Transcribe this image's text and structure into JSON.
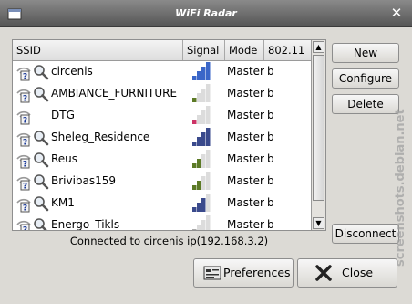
{
  "window": {
    "title": "WiFi Radar"
  },
  "columns": {
    "ssid": "SSID",
    "signal": "Signal",
    "mode": "Mode",
    "standard": "802.11"
  },
  "networks": [
    {
      "ssid": "circenis",
      "signal_bars": 4,
      "signal_color": "#3a66c8",
      "mode": "Master",
      "standard": "b"
    },
    {
      "ssid": "AMBIANCE_FURNITURE",
      "signal_bars": 1,
      "signal_color": "#5c7a26",
      "mode": "Master",
      "standard": "b"
    },
    {
      "ssid": "DTG",
      "signal_bars": 1,
      "signal_color": "#cc3366",
      "mode": "Master",
      "standard": "b"
    },
    {
      "ssid": "Sheleg_Residence",
      "signal_bars": 4,
      "signal_color": "#3a4a8c",
      "mode": "Master",
      "standard": "b"
    },
    {
      "ssid": "Reus",
      "signal_bars": 2,
      "signal_color": "#5c7a26",
      "mode": "Master",
      "standard": "b"
    },
    {
      "ssid": "Brivibas159",
      "signal_bars": 2,
      "signal_color": "#5c7a26",
      "mode": "Master",
      "standard": "b"
    },
    {
      "ssid": "KM1",
      "signal_bars": 3,
      "signal_color": "#3a4a8c",
      "mode": "Master",
      "standard": "b"
    },
    {
      "ssid": "Energo_Tikls",
      "signal_bars": 1,
      "signal_color": "#aaaaaa",
      "mode": "Master",
      "standard": "b"
    }
  ],
  "buttons": {
    "new_label": "New",
    "configure_label": "Configure",
    "delete_label": "Delete",
    "disconnect_label": "Disconnect",
    "preferences_label": "Preferences",
    "close_label": "Close"
  },
  "status": {
    "text": "Connected to circenis ip(192.168.3.2)"
  },
  "watermark": "screenshots.debian.net"
}
